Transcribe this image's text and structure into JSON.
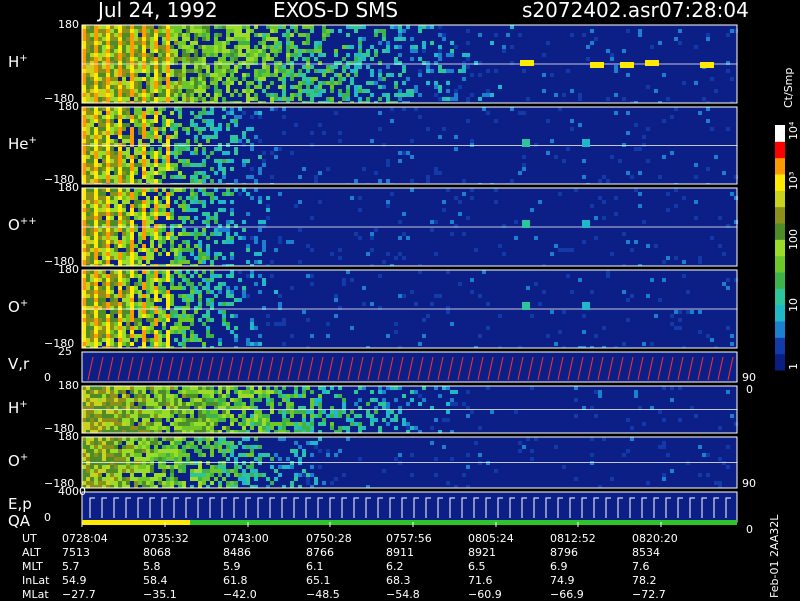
{
  "header": {
    "date": "Jul 24, 1992",
    "instrument": "EXOS-D SMS",
    "file": "s2072402.asr",
    "time": "07:28:04"
  },
  "panels": [
    {
      "label": "H",
      "sup": "+",
      "ytop": "180",
      "ybot": "−180",
      "type": "angle"
    },
    {
      "label": "He",
      "sup": "+",
      "ytop": "180",
      "ybot": "−180",
      "type": "angle"
    },
    {
      "label": "O",
      "sup": "++",
      "ytop": "180",
      "ybot": "−180",
      "type": "angle"
    },
    {
      "label": "O",
      "sup": "+",
      "ytop": "180",
      "ybot": "−180",
      "type": "angle"
    },
    {
      "label": "V,r",
      "sup": "",
      "ytop": "25",
      "ybot": "0",
      "right": "90",
      "right_bottom": "0",
      "type": "line"
    },
    {
      "label": "H",
      "sup": "+",
      "ytop": "180",
      "ybot": "−180",
      "type": "angle2"
    },
    {
      "label": "O",
      "sup": "+",
      "ytop": "180",
      "ybot": "−180",
      "right": "90",
      "type": "angle3"
    },
    {
      "label": "E,p",
      "sup": "",
      "label2": "QA",
      "ytop": "4000",
      "ybot": "0",
      "right_bottom": "0",
      "type": "energy"
    }
  ],
  "colorbar": {
    "unit": "Ct/Smp",
    "ticks": [
      "10⁴",
      "10³",
      "100",
      "10",
      "1"
    ]
  },
  "footer": {
    "rows": [
      {
        "label": "UT",
        "values": [
          "0728:04",
          "0735:32",
          "0743:00",
          "0750:28",
          "0757:56",
          "0805:24",
          "0812:52",
          "0820:20"
        ]
      },
      {
        "label": "ALT",
        "values": [
          "7513",
          "8068",
          "8486",
          "8766",
          "8911",
          "8921",
          "8796",
          "8534"
        ]
      },
      {
        "label": "MLT",
        "values": [
          "5.7",
          "5.8",
          "5.9",
          "6.1",
          "6.2",
          "6.5",
          "6.9",
          "7.6"
        ]
      },
      {
        "label": "InLat",
        "values": [
          "54.9",
          "58.4",
          "61.8",
          "65.1",
          "68.3",
          "71.6",
          "74.9",
          "78.2"
        ]
      },
      {
        "label": "MLat",
        "values": [
          "−27.7",
          "−35.1",
          "−42.0",
          "−48.5",
          "−54.8",
          "−60.9",
          "−66.9",
          "−72.7"
        ]
      }
    ],
    "side_label": "Feb-01 2AA32L"
  },
  "chart_data": {
    "type": "heatmap",
    "title": "Jul 24, 1992   EXOS-D SMS",
    "x_tick_labels": [
      "0728:04",
      "0735:32",
      "0743:00",
      "0750:28",
      "0757:56",
      "0805:24",
      "0812:52",
      "0820:20"
    ],
    "series": [
      {
        "name": "H+",
        "ylim": [
          -180,
          180
        ]
      },
      {
        "name": "He+",
        "ylim": [
          -180,
          180
        ]
      },
      {
        "name": "O++",
        "ylim": [
          -180,
          180
        ]
      },
      {
        "name": "O+",
        "ylim": [
          -180,
          180
        ]
      },
      {
        "name": "V,r",
        "ylim": [
          0,
          25
        ]
      },
      {
        "name": "H+",
        "ylim": [
          -180,
          180
        ]
      },
      {
        "name": "O+",
        "ylim": [
          -180,
          180
        ]
      },
      {
        "name": "E,p",
        "ylim": [
          0,
          4000
        ]
      }
    ],
    "colorscale": {
      "unit": "Ct/Smp",
      "log": true,
      "range": [
        1,
        10000
      ]
    }
  }
}
